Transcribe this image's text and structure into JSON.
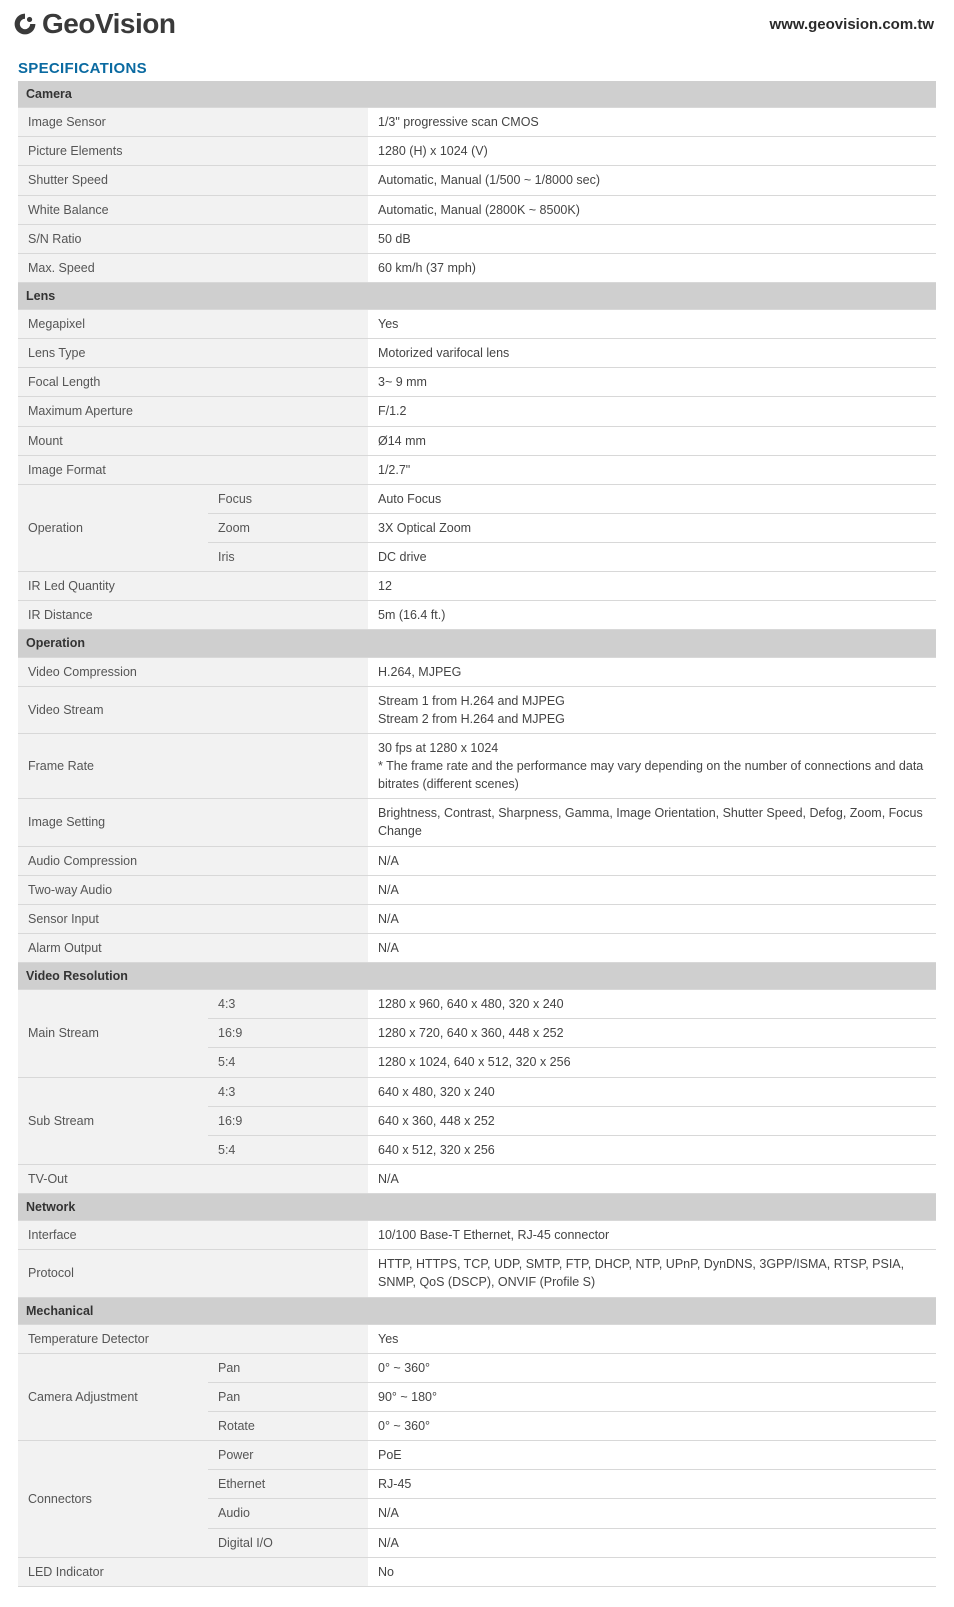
{
  "header": {
    "brand": "GeoVision",
    "url": "www.geovision.com.tw"
  },
  "title": "SPECIFICATIONS",
  "sections": {
    "camera": {
      "name": "Camera",
      "image_sensor": {
        "label": "Image Sensor",
        "value": "1/3\" progressive scan CMOS"
      },
      "picture_elements": {
        "label": "Picture Elements",
        "value": "1280 (H) x 1024 (V)"
      },
      "shutter_speed": {
        "label": "Shutter Speed",
        "value": "Automatic, Manual (1/500 ~ 1/8000 sec)"
      },
      "white_balance": {
        "label": "White Balance",
        "value": "Automatic, Manual (2800K ~ 8500K)"
      },
      "sn_ratio": {
        "label": "S/N Ratio",
        "value": "50 dB"
      },
      "max_speed": {
        "label": "Max. Speed",
        "value": "60 km/h (37 mph)"
      }
    },
    "lens": {
      "name": "Lens",
      "megapixel": {
        "label": "Megapixel",
        "value": "Yes"
      },
      "lens_type": {
        "label": "Lens Type",
        "value": "Motorized varifocal lens"
      },
      "focal_length": {
        "label": "Focal Length",
        "value": "3~ 9 mm"
      },
      "max_aperture": {
        "label": "Maximum Aperture",
        "value": "F/1.2"
      },
      "mount": {
        "label": "Mount",
        "value": "Ø14 mm"
      },
      "image_format": {
        "label": "Image Format",
        "value": "1/2.7\""
      },
      "operation": {
        "label": "Operation",
        "focus": {
          "label": "Focus",
          "value": "Auto Focus"
        },
        "zoom": {
          "label": "Zoom",
          "value": "3X Optical Zoom"
        },
        "iris": {
          "label": "Iris",
          "value": "DC drive"
        }
      },
      "ir_led_quantity": {
        "label": "IR Led Quantity",
        "value": "12"
      },
      "ir_distance": {
        "label": "IR Distance",
        "value": "5m (16.4 ft.)"
      }
    },
    "operation": {
      "name": "Operation",
      "video_compression": {
        "label": "Video Compression",
        "value": "H.264, MJPEG"
      },
      "video_stream": {
        "label": "Video Stream",
        "value": "Stream 1 from H.264 and MJPEG\nStream 2 from H.264 and MJPEG"
      },
      "frame_rate": {
        "label": "Frame Rate",
        "value": "30 fps at 1280 x 1024\n* The frame rate and the performance may vary depending on the number of connections and data bitrates (different scenes)"
      },
      "image_setting": {
        "label": "Image Setting",
        "value": "Brightness, Contrast, Sharpness, Gamma, Image Orientation, Shutter Speed, Defog, Zoom, Focus Change"
      },
      "audio_compression": {
        "label": "Audio Compression",
        "value": "N/A"
      },
      "two_way_audio": {
        "label": "Two-way Audio",
        "value": "N/A"
      },
      "sensor_input": {
        "label": "Sensor Input",
        "value": "N/A"
      },
      "alarm_output": {
        "label": "Alarm Output",
        "value": "N/A"
      }
    },
    "video_resolution": {
      "name": "Video Resolution",
      "main_stream": {
        "label": "Main Stream",
        "r43": {
          "label": "4:3",
          "value": "1280 x 960, 640 x 480, 320 x 240"
        },
        "r169": {
          "label": "16:9",
          "value": "1280 x 720, 640 x 360, 448 x 252"
        },
        "r54": {
          "label": "5:4",
          "value": "1280 x 1024, 640 x 512, 320 x 256"
        }
      },
      "sub_stream": {
        "label": "Sub Stream",
        "r43": {
          "label": "4:3",
          "value": "640 x 480, 320 x 240"
        },
        "r169": {
          "label": "16:9",
          "value": "640 x 360, 448 x 252"
        },
        "r54": {
          "label": "5:4",
          "value": "640 x 512, 320 x 256"
        }
      },
      "tv_out": {
        "label": "TV-Out",
        "value": "N/A"
      }
    },
    "network": {
      "name": "Network",
      "interface": {
        "label": "Interface",
        "value": "10/100 Base-T Ethernet, RJ-45 connector"
      },
      "protocol": {
        "label": "Protocol",
        "value": "HTTP, HTTPS, TCP, UDP, SMTP, FTP, DHCP, NTP, UPnP, DynDNS, 3GPP/ISMA, RTSP, PSIA, SNMP, QoS (DSCP), ONVIF (Profile S)"
      }
    },
    "mechanical": {
      "name": "Mechanical",
      "temperature_detector": {
        "label": "Temperature Detector",
        "value": "Yes"
      },
      "camera_adjustment": {
        "label": "Camera Adjustment",
        "pan1": {
          "label": "Pan",
          "value": "0° ~ 360°"
        },
        "pan2": {
          "label": "Pan",
          "value": "90° ~ 180°"
        },
        "rotate": {
          "label": "Rotate",
          "value": "0° ~ 360°"
        }
      },
      "connectors": {
        "label": "Connectors",
        "power": {
          "label": "Power",
          "value": "PoE"
        },
        "ethernet": {
          "label": "Ethernet",
          "value": "RJ-45"
        },
        "audio": {
          "label": "Audio",
          "value": "N/A"
        },
        "digital_io": {
          "label": "Digital I/O",
          "value": "N/A"
        }
      },
      "led_indicator": {
        "label": "LED Indicator",
        "value": "No"
      }
    }
  }
}
